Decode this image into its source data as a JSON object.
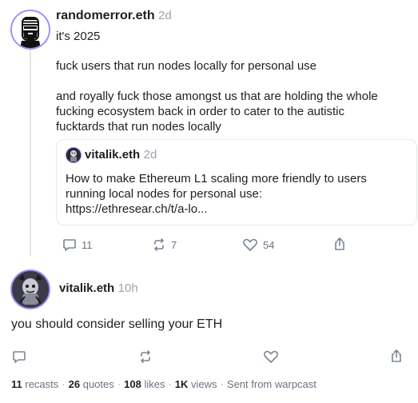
{
  "post": {
    "author": "randomerror.eth",
    "time": "2d",
    "line1": "it's 2025",
    "para1": "fuck users that run nodes locally for personal use",
    "para2_l1": "and royally fuck those amongst us that are holding the whole",
    "para2_l2": "fucking ecosystem back in order to cater to the autistic",
    "para2_l3": "fucktards that run nodes locally",
    "quote": {
      "author": "vitalik.eth",
      "time": "2d",
      "l1": "How to make Ethereum L1 scaling more friendly to users",
      "l2": "running local nodes for personal use:",
      "l3": "https://ethresear.ch/t/a-lo..."
    },
    "actions": {
      "replies": "11",
      "recasts": "7",
      "likes": "54"
    }
  },
  "reply": {
    "author": "vitalik.eth",
    "time": "10h",
    "text": "you should consider selling your ETH"
  },
  "stats": {
    "recasts_count": "11",
    "recasts_label": "recasts",
    "quotes_count": "26",
    "quotes_label": "quotes",
    "likes_count": "108",
    "likes_label": "likes",
    "views_count": "1K",
    "views_label": "views",
    "source": "Sent from warpcast",
    "separator": "·"
  },
  "colors": {
    "avatar_ring": "#a78bfa",
    "muted": "#6b7280",
    "icon": "#7c8594"
  },
  "icons": [
    "comment-icon",
    "recast-icon",
    "heart-icon",
    "share-icon"
  ]
}
